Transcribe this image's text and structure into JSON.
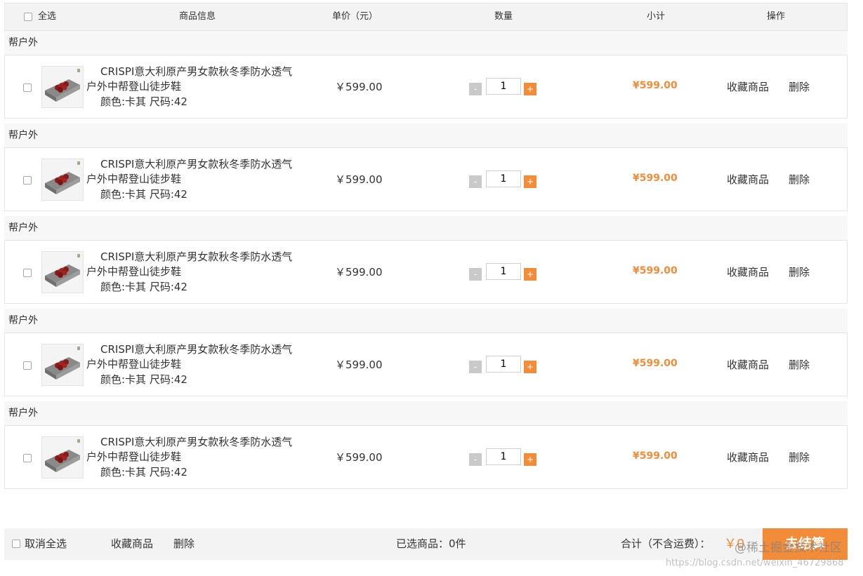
{
  "header": {
    "select_all": "全选",
    "product_info": "商品信息",
    "unit_price": "单价（元）",
    "quantity": "数量",
    "subtotal": "小计",
    "operation": "操作"
  },
  "groups": [
    {
      "shop": "帮户外",
      "item": {
        "name": "CRISPI意大利原产男女款秋冬季防水透气户外中帮登山徒步鞋",
        "attrs": "颜色:卡其 尺码:42",
        "price": "￥599.00",
        "qty": "1",
        "subtotal": "¥599.00",
        "fav": "收藏商品",
        "del": "删除"
      }
    },
    {
      "shop": "帮户外",
      "item": {
        "name": "CRISPI意大利原产男女款秋冬季防水透气户外中帮登山徒步鞋",
        "attrs": "颜色:卡其 尺码:42",
        "price": "￥599.00",
        "qty": "1",
        "subtotal": "¥599.00",
        "fav": "收藏商品",
        "del": "删除"
      }
    },
    {
      "shop": "帮户外",
      "item": {
        "name": "CRISPI意大利原产男女款秋冬季防水透气户外中帮登山徒步鞋",
        "attrs": "颜色:卡其 尺码:42",
        "price": "￥599.00",
        "qty": "1",
        "subtotal": "¥599.00",
        "fav": "收藏商品",
        "del": "删除"
      }
    },
    {
      "shop": "帮户外",
      "item": {
        "name": "CRISPI意大利原产男女款秋冬季防水透气户外中帮登山徒步鞋",
        "attrs": "颜色:卡其 尺码:42",
        "price": "￥599.00",
        "qty": "1",
        "subtotal": "¥599.00",
        "fav": "收藏商品",
        "del": "删除"
      }
    },
    {
      "shop": "帮户外",
      "item": {
        "name": "CRISPI意大利原产男女款秋冬季防水透气户外中帮登山徒步鞋",
        "attrs": "颜色:卡其 尺码:42",
        "price": "￥599.00",
        "qty": "1",
        "subtotal": "¥599.00",
        "fav": "收藏商品",
        "del": "删除"
      }
    }
  ],
  "qty_controls": {
    "minus": "-",
    "plus": "+"
  },
  "footer": {
    "cancel_all": "取消全选",
    "fav": "收藏商品",
    "del": "删除",
    "selected": "已选商品：0件",
    "total_label": "合计（不含运费）：",
    "total_value": "￥0",
    "checkout": "去结算"
  },
  "watermark": {
    "main": "@稀土掘金技术社区",
    "url": "https://blog.csdn.net/weixin_46729868"
  },
  "colors": {
    "accent": "#f28c38",
    "header_bg": "#f3f3f3",
    "border": "#e6e6e6"
  },
  "icons": {
    "minus": "minus-icon",
    "plus": "plus-icon"
  }
}
